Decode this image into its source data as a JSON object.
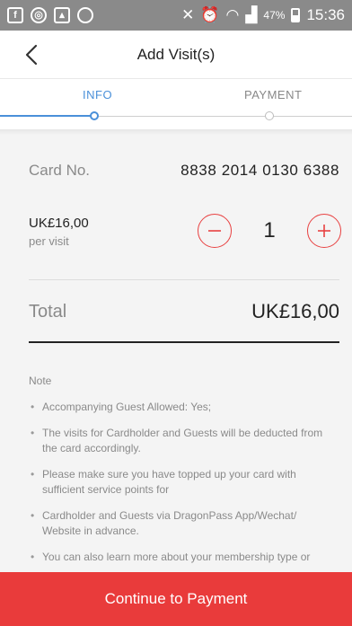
{
  "status_bar": {
    "battery_percent": "47%",
    "time": "15:36"
  },
  "header": {
    "title": "Add Visit(s)"
  },
  "stepper": {
    "steps": [
      {
        "label": "INFO",
        "active": true
      },
      {
        "label": "PAYMENT",
        "active": false
      }
    ]
  },
  "card": {
    "label": "Card No.",
    "number": "8838 2014 0130 6388"
  },
  "price": {
    "amount": "UK£16,00",
    "unit": "per visit"
  },
  "quantity": {
    "value": "1"
  },
  "total": {
    "label": "Total",
    "value": "UK£16,00"
  },
  "notes": {
    "title": "Note",
    "items": [
      "Accompanying Guest Allowed: Yes;",
      "The visits for Cardholder and Guests will be deducted from the card accordingly.",
      "Please make sure you have topped up your card with sufficient service points for",
      "Cardholder and Guests via DragonPass App/Wechat/ Website in advance.",
      "You can also learn more about your membership type or"
    ]
  },
  "cta": {
    "label": "Continue to Payment"
  },
  "colors": {
    "accent_blue": "#4a90d9",
    "accent_red": "#e93b3b",
    "status_bar": "#8a8a8a"
  }
}
